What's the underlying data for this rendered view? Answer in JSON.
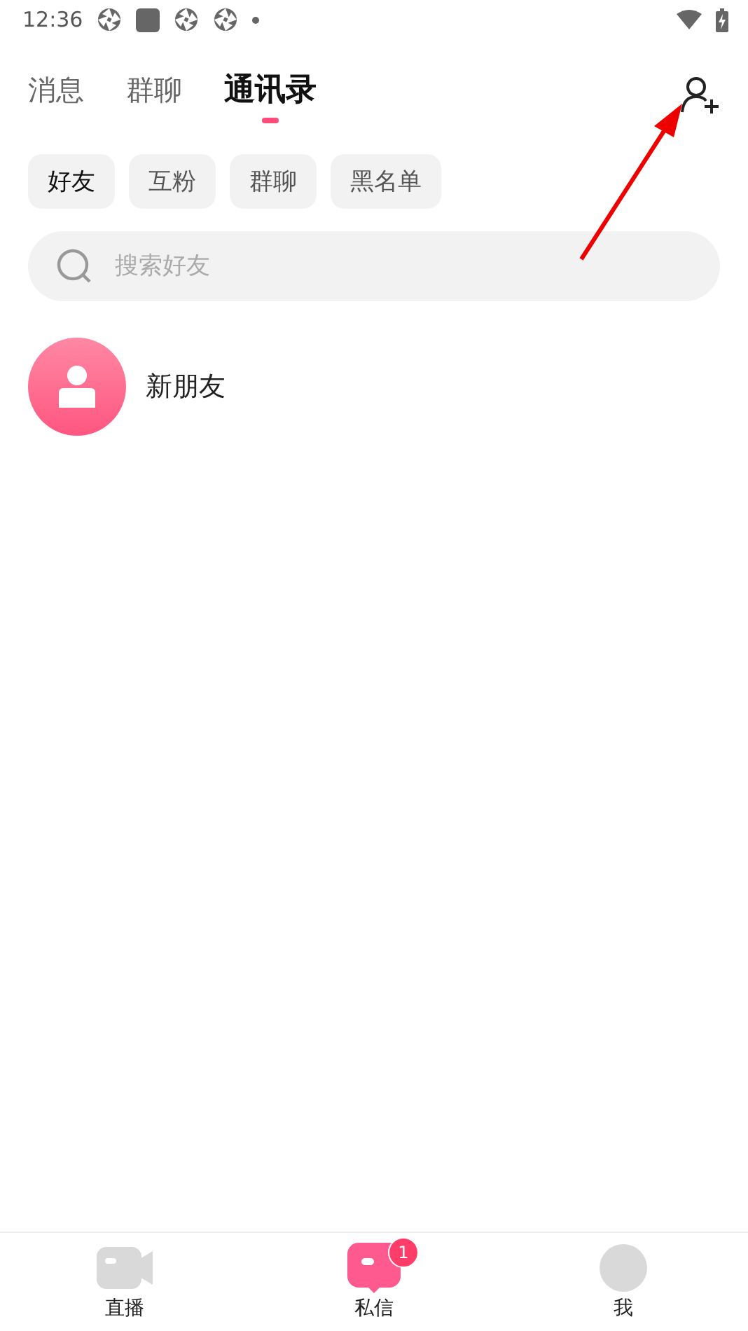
{
  "status_bar": {
    "time": "12:36"
  },
  "tabs": [
    {
      "label": "消息",
      "selected": false
    },
    {
      "label": "群聊",
      "selected": false
    },
    {
      "label": "通讯录",
      "selected": true
    }
  ],
  "filters": [
    {
      "label": "好友",
      "selected": true
    },
    {
      "label": "互粉",
      "selected": false
    },
    {
      "label": "群聊",
      "selected": false
    },
    {
      "label": "黑名单",
      "selected": false
    }
  ],
  "search": {
    "placeholder": "搜索好友"
  },
  "contacts": [
    {
      "name": "新朋友"
    }
  ],
  "bottom_nav": [
    {
      "label": "直播",
      "kind": "camera",
      "selected": false
    },
    {
      "label": "私信",
      "kind": "message",
      "selected": true,
      "badge": "1"
    },
    {
      "label": "我",
      "kind": "profile",
      "selected": false
    }
  ]
}
